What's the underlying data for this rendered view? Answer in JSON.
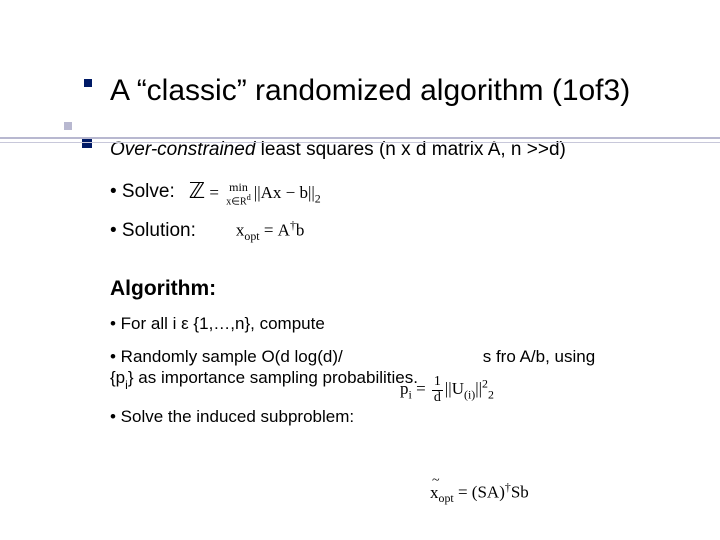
{
  "title": "A “classic” randomized algorithm (1of3)",
  "subtitle_em": "Over-constrained",
  "subtitle_rest": " least squares (n x d matrix A, n >>d)",
  "solve_label": "• Solve:",
  "solution_label": "• Solution:",
  "algorithm_header": "Algorithm:",
  "step1": "• For all i ε {1,…,n}, compute",
  "step2_a": "• Randomly sample O(d log(d)/",
  "step2_b": "s fro A/b, using",
  "step2_c": "{p",
  "step2_c_sub": "i",
  "step2_d": "} as importance sampling probabilities.",
  "step3": "• Solve the induced subproblem:",
  "formulas": {
    "solve": {
      "Z": "ℤ",
      "eq": " = ",
      "min_top": "min",
      "min_bot": "x∈R",
      "min_bot_sup": "d",
      "norm_l": "||",
      "expr": "Ax − b",
      "norm_r": "||",
      "sub": "2"
    },
    "solution": {
      "x": "x",
      "xsub": "opt",
      "eq": " = ",
      "A": "A",
      "dag": "†",
      "b": "b"
    },
    "pi": {
      "p": "p",
      "psub": "i",
      "eq": " = ",
      "num": "1",
      "den": "d",
      "norm_l": "||",
      "U": "U",
      "i": "(i)",
      "norm_r": "||",
      "sup": "2",
      "sub": "2"
    },
    "final": {
      "x": "x",
      "xsub": "opt",
      "eq": " = (",
      "SA": "SA",
      "rp": ")",
      "dag": "†",
      "Sb": "Sb"
    }
  }
}
